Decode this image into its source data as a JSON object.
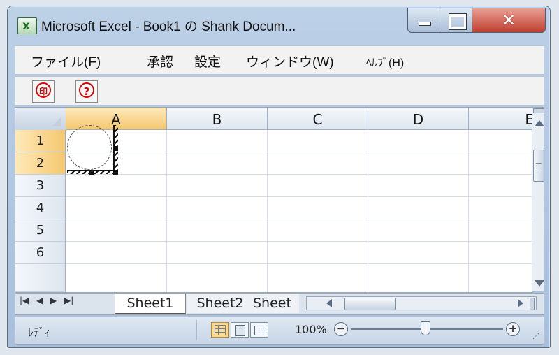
{
  "window": {
    "title": "Microsoft Excel - Book1 の Shank Docum...",
    "app_icon_glyph": "x"
  },
  "menu": {
    "items": [
      "ファイル(F)",
      "承認",
      "設定",
      "ウィンドウ(W)",
      "ﾍﾙﾌﾟ(H)"
    ]
  },
  "toolbar": {
    "print_label": "印",
    "help_label": "?"
  },
  "sheet": {
    "columns": [
      "A",
      "B",
      "C",
      "D",
      "E"
    ],
    "rows": [
      "1",
      "2",
      "3",
      "4",
      "5",
      "6"
    ],
    "selected_column": "A"
  },
  "tabs": {
    "items": [
      "Sheet1",
      "Sheet2",
      "Sheet"
    ],
    "active": "Sheet1",
    "nav_first": "|◀",
    "nav_prev": "◀",
    "nav_next": "▶",
    "nav_last": "▶|"
  },
  "status": {
    "text": "ﾚﾃﾞｨ",
    "zoom": "100%",
    "zoom_out_label": "−",
    "zoom_in_label": "+",
    "zoom_level_fraction": 0.5
  },
  "colors": {
    "accent": "#d00000",
    "selected_header": "#f4c770"
  }
}
